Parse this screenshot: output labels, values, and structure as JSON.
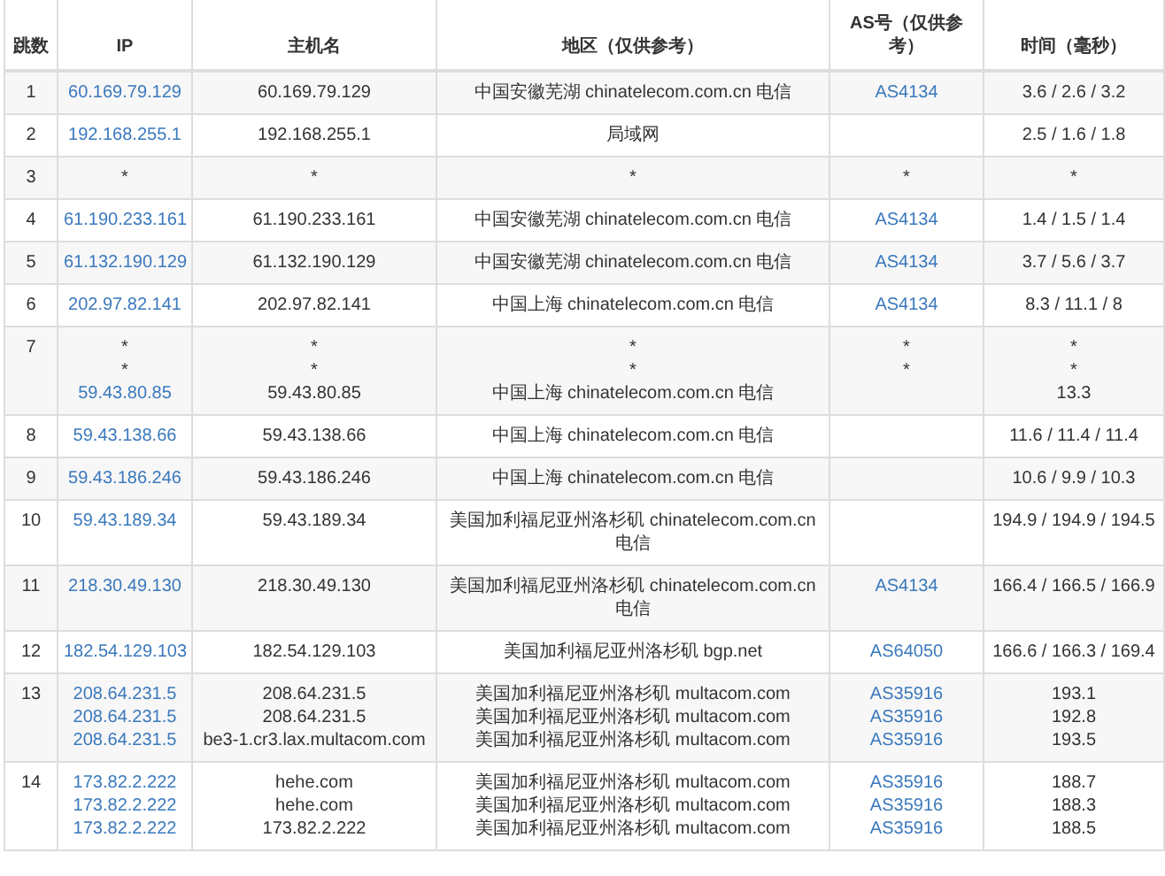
{
  "table": {
    "columns": [
      "跳数",
      "IP",
      "主机名",
      "地区（仅供参考）",
      "AS号（仅供参考）",
      "时间（毫秒）"
    ],
    "rows": [
      {
        "hop": "1",
        "lines": [
          {
            "ip": "60.169.79.129",
            "host": "60.169.79.129",
            "region": "中国安徽芜湖 chinatelecom.com.cn 电信",
            "as": "AS4134",
            "time": "3.6 / 2.6 / 3.2"
          }
        ]
      },
      {
        "hop": "2",
        "lines": [
          {
            "ip": "192.168.255.1",
            "host": "192.168.255.1",
            "region": "局域网",
            "time": "2.5 / 1.6 / 1.8"
          }
        ]
      },
      {
        "hop": "3",
        "lines": [
          {
            "ip": "*",
            "host": "*",
            "region": "*",
            "as": "*",
            "time": "*"
          }
        ]
      },
      {
        "hop": "4",
        "lines": [
          {
            "ip": "61.190.233.161",
            "host": "61.190.233.161",
            "region": "中国安徽芜湖 chinatelecom.com.cn 电信",
            "as": "AS4134",
            "time": "1.4 / 1.5 / 1.4"
          }
        ]
      },
      {
        "hop": "5",
        "lines": [
          {
            "ip": "61.132.190.129",
            "host": "61.132.190.129",
            "region": "中国安徽芜湖 chinatelecom.com.cn 电信",
            "as": "AS4134",
            "time": "3.7 / 5.6 / 3.7"
          }
        ]
      },
      {
        "hop": "6",
        "lines": [
          {
            "ip": "202.97.82.141",
            "host": "202.97.82.141",
            "region": "中国上海 chinatelecom.com.cn 电信",
            "as": "AS4134",
            "time": "8.3 / 11.1 / 8"
          }
        ]
      },
      {
        "hop": "7",
        "lines": [
          {
            "ip": "*",
            "host": "*",
            "region": "*",
            "as": "*",
            "time": "*"
          },
          {
            "ip": "*",
            "host": "*",
            "region": "*",
            "as": "*",
            "time": "*"
          },
          {
            "ip": "59.43.80.85",
            "host": "59.43.80.85",
            "region": "中国上海 chinatelecom.com.cn 电信",
            "time": "13.3"
          }
        ]
      },
      {
        "hop": "8",
        "lines": [
          {
            "ip": "59.43.138.66",
            "host": "59.43.138.66",
            "region": "中国上海 chinatelecom.com.cn 电信",
            "time": "11.6 / 11.4 / 11.4"
          }
        ]
      },
      {
        "hop": "9",
        "lines": [
          {
            "ip": "59.43.186.246",
            "host": "59.43.186.246",
            "region": "中国上海 chinatelecom.com.cn 电信",
            "time": "10.6 / 9.9 / 10.3"
          }
        ]
      },
      {
        "hop": "10",
        "lines": [
          {
            "ip": "59.43.189.34",
            "host": "59.43.189.34",
            "region": "美国加利福尼亚州洛杉矶 chinatelecom.com.cn 电信",
            "time": "194.9 / 194.9 / 194.5"
          }
        ]
      },
      {
        "hop": "11",
        "lines": [
          {
            "ip": "218.30.49.130",
            "host": "218.30.49.130",
            "region": "美国加利福尼亚州洛杉矶 chinatelecom.com.cn 电信",
            "as": "AS4134",
            "time": "166.4 / 166.5 / 166.9"
          }
        ]
      },
      {
        "hop": "12",
        "lines": [
          {
            "ip": "182.54.129.103",
            "host": "182.54.129.103",
            "region": "美国加利福尼亚州洛杉矶 bgp.net",
            "as": "AS64050",
            "time": "166.6 / 166.3 / 169.4"
          }
        ]
      },
      {
        "hop": "13",
        "lines": [
          {
            "ip": "208.64.231.5",
            "host": "208.64.231.5",
            "region": "美国加利福尼亚州洛杉矶 multacom.com",
            "as": "AS35916",
            "time": "193.1"
          },
          {
            "ip": "208.64.231.5",
            "host": "208.64.231.5",
            "region": "美国加利福尼亚州洛杉矶 multacom.com",
            "as": "AS35916",
            "time": "192.8"
          },
          {
            "ip": "208.64.231.5",
            "host": "be3-1.cr3.lax.multacom.com",
            "region": "美国加利福尼亚州洛杉矶 multacom.com",
            "as": "AS35916",
            "time": "193.5"
          }
        ]
      },
      {
        "hop": "14",
        "lines": [
          {
            "ip": "173.82.2.222",
            "host": "hehe.com",
            "region": "美国加利福尼亚州洛杉矶 multacom.com",
            "as": "AS35916",
            "time": "188.7"
          },
          {
            "ip": "173.82.2.222",
            "host": "hehe.com",
            "region": "美国加利福尼亚州洛杉矶 multacom.com",
            "as": "AS35916",
            "time": "188.3"
          },
          {
            "ip": "173.82.2.222",
            "host": "173.82.2.222",
            "region": "美国加利福尼亚州洛杉矶 multacom.com",
            "as": "AS35916",
            "time": "188.5"
          }
        ]
      }
    ]
  }
}
